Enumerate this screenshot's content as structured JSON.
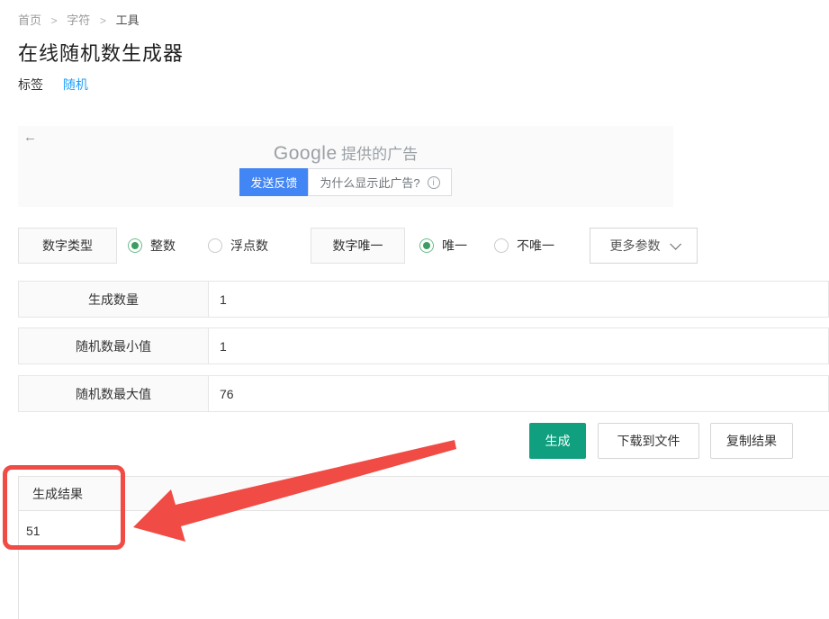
{
  "breadcrumb": {
    "separator": ">",
    "items": [
      "首页",
      "字符",
      "工具"
    ]
  },
  "page": {
    "title": "在线随机数生成器"
  },
  "tags": {
    "label": "标签",
    "tag": "随机"
  },
  "ad": {
    "back_icon": "←",
    "brand": "Google",
    "caption": "提供的广告",
    "feedback_button": "发送反馈",
    "why_button": "为什么显示此广告?",
    "info_glyph": "i"
  },
  "controls": {
    "number_type": {
      "label": "数字类型",
      "options": [
        {
          "label": "整数",
          "selected": true
        },
        {
          "label": "浮点数",
          "selected": false
        }
      ]
    },
    "uniqueness": {
      "label": "数字唯一",
      "options": [
        {
          "label": "唯一",
          "selected": true
        },
        {
          "label": "不唯一",
          "selected": false
        }
      ]
    },
    "more_params": {
      "label": "更多参数"
    }
  },
  "fields": [
    {
      "label": "生成数量",
      "value": "1"
    },
    {
      "label": "随机数最小值",
      "value": "1"
    },
    {
      "label": "随机数最大值",
      "value": "76"
    }
  ],
  "actions": {
    "generate": "生成",
    "download": "下载到文件",
    "copy": "复制结果"
  },
  "result": {
    "header": "生成结果",
    "value": "51"
  },
  "colors": {
    "accent_green": "#11a07f",
    "radio_green": "#3b9d61",
    "link_blue": "#1e9fff",
    "feedback_blue": "#4285f4",
    "annotation_red": "#f04b44",
    "ad_background": "#fafafa"
  }
}
